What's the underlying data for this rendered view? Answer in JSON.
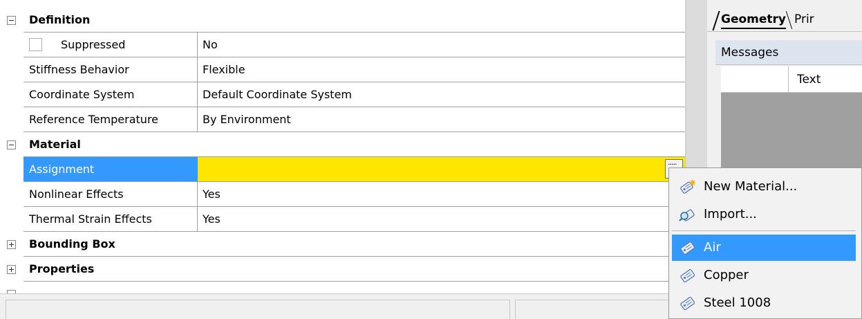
{
  "property_grid": {
    "groups": {
      "definition": {
        "title": "Definition",
        "rows": [
          {
            "label": "Suppressed",
            "value": "No"
          },
          {
            "label": "Stiffness Behavior",
            "value": "Flexible"
          },
          {
            "label": "Coordinate System",
            "value": "Default Coordinate System"
          },
          {
            "label": "Reference Temperature",
            "value": "By Environment"
          }
        ]
      },
      "material": {
        "title": "Material",
        "rows": [
          {
            "label": "Assignment",
            "value": ""
          },
          {
            "label": "Nonlinear Effects",
            "value": "Yes"
          },
          {
            "label": "Thermal Strain Effects",
            "value": "Yes"
          }
        ]
      },
      "bounding_box": {
        "title": "Bounding Box"
      },
      "properties": {
        "title": "Properties"
      }
    },
    "selected_row": "Assignment",
    "colors": {
      "selection_blue": "#3399ff",
      "value_highlight": "#ffe600"
    }
  },
  "right_panel": {
    "tabs": [
      {
        "label": "Geometry",
        "active": true
      },
      {
        "label": "Prir",
        "active": false
      }
    ],
    "messages": {
      "title": "Messages",
      "column_text": "Text"
    }
  },
  "material_menu": {
    "items": [
      {
        "label": "New Material...",
        "icon": "new-material-icon"
      },
      {
        "label": "Import...",
        "icon": "import-icon"
      },
      {
        "label": "Air",
        "icon": "material-tag-icon",
        "selected": true
      },
      {
        "label": "Copper",
        "icon": "material-tag-icon"
      },
      {
        "label": "Steel 1008",
        "icon": "material-tag-icon"
      }
    ]
  }
}
